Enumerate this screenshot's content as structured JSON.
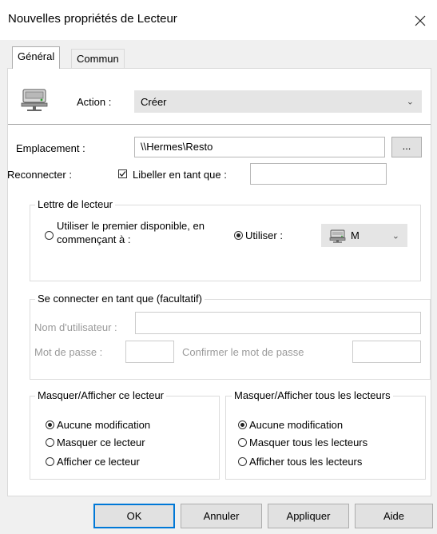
{
  "window": {
    "title": "Nouvelles propriétés de Lecteur",
    "close_icon": "close-icon"
  },
  "tabs": [
    {
      "label": "Général",
      "active": true
    },
    {
      "label": "Commun",
      "active": false
    }
  ],
  "action": {
    "label": "Action :",
    "value": "Créer",
    "icon": "network-drive-icon"
  },
  "emplacement": {
    "label": "Emplacement :",
    "value": "\\\\Hermes\\Resto",
    "browse_label": "..."
  },
  "reconnect": {
    "label": "Reconnecter :",
    "checked": true,
    "libeller_label": "Libeller en tant que :",
    "libeller_value": ""
  },
  "drive_letter": {
    "legend": "Lettre de lecteur",
    "option_first_line1": "Utiliser le premier disponible, en",
    "option_first_line2": "commençant à :",
    "option_use": "Utiliser :",
    "selected": "use",
    "letter": "M"
  },
  "connect_as": {
    "legend": "Se connecter en tant que (facultatif)",
    "username_label": "Nom d'utilisateur :",
    "username_value": "",
    "password_label": "Mot de passe :",
    "password_value": "",
    "confirm_label": "Confirmer le mot de passe",
    "confirm_value": ""
  },
  "hide_this": {
    "legend": "Masquer/Afficher ce lecteur",
    "options": [
      "Aucune modification",
      "Masquer ce lecteur",
      "Afficher ce lecteur"
    ],
    "selected": 0
  },
  "hide_all": {
    "legend": "Masquer/Afficher tous les lecteurs",
    "options": [
      "Aucune modification",
      "Masquer tous les lecteurs",
      "Afficher tous les lecteurs"
    ],
    "selected": 0
  },
  "buttons": {
    "ok": "OK",
    "cancel": "Annuler",
    "apply": "Appliquer",
    "help": "Aide"
  },
  "colors": {
    "accent": "#0078d7",
    "panel": "#f0f0f0",
    "combo": "#e5e5e5"
  }
}
